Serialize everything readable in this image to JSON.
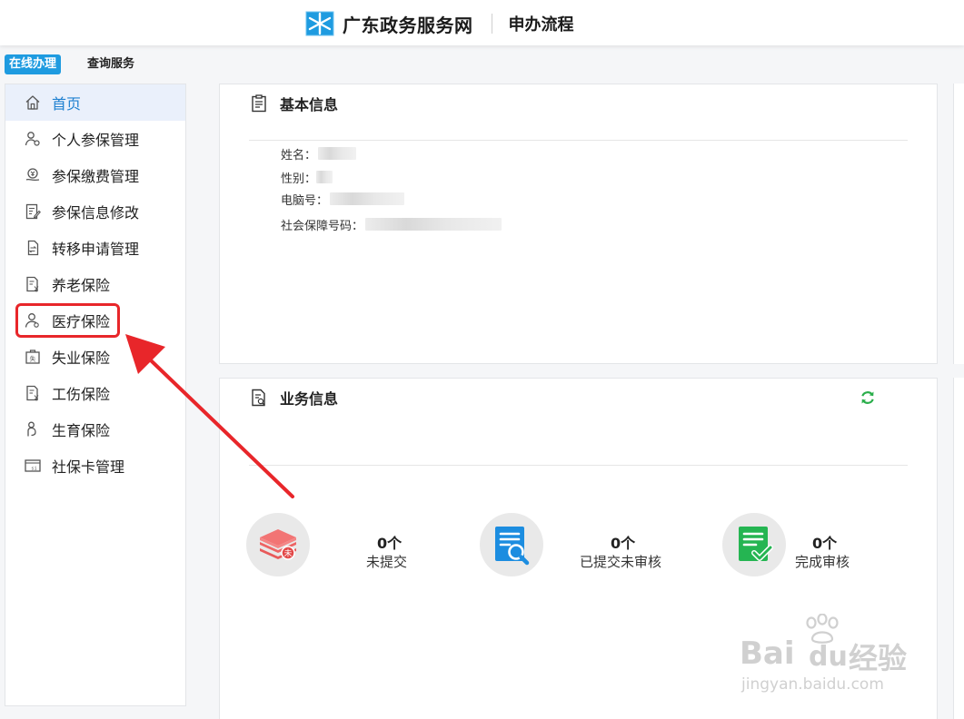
{
  "header": {
    "site_name": "广东政务服务网",
    "section": "申办流程"
  },
  "mode_tabs": [
    {
      "label": "在线办理",
      "active": true
    },
    {
      "label": "查询服务",
      "active": false
    }
  ],
  "sidebar": {
    "items": [
      {
        "label": "首页",
        "icon": "home-icon",
        "active": true
      },
      {
        "label": "个人参保管理",
        "icon": "user-group-icon"
      },
      {
        "label": "参保缴费管理",
        "icon": "payment-icon"
      },
      {
        "label": "参保信息修改",
        "icon": "edit-doc-icon"
      },
      {
        "label": "转移申请管理",
        "icon": "transfer-icon"
      },
      {
        "label": "养老保险",
        "icon": "pension-doc-icon"
      },
      {
        "label": "医疗保险",
        "icon": "medical-user-icon",
        "highlighted": true
      },
      {
        "label": "失业保险",
        "icon": "unemployment-icon"
      },
      {
        "label": "工伤保险",
        "icon": "injury-doc-icon"
      },
      {
        "label": "生育保险",
        "icon": "maternity-icon"
      },
      {
        "label": "社保卡管理",
        "icon": "card-icon"
      }
    ]
  },
  "basic_info": {
    "title": "基本信息",
    "fields": [
      {
        "label": "姓名："
      },
      {
        "label": "性别："
      },
      {
        "label": "电脑号："
      },
      {
        "label": "社会保障号码："
      }
    ]
  },
  "business_info": {
    "title": "业务信息",
    "stats": [
      {
        "count": "0个",
        "label": "未提交",
        "icon": "stack-icon"
      },
      {
        "count": "0个",
        "label": "已提交未审核",
        "icon": "search-doc-icon"
      },
      {
        "count": "0个",
        "label": "完成审核",
        "icon": "approved-doc-icon"
      }
    ]
  },
  "colors": {
    "accent": "#1e9be0",
    "active_nav_bg": "#eaf0fb",
    "highlight_red": "#e8262a",
    "refresh_green": "#2aae4b"
  },
  "watermark": {
    "brand": "Bai",
    "brand2": "du",
    "brand3": "经验",
    "url": "jingyan.baidu.com"
  }
}
